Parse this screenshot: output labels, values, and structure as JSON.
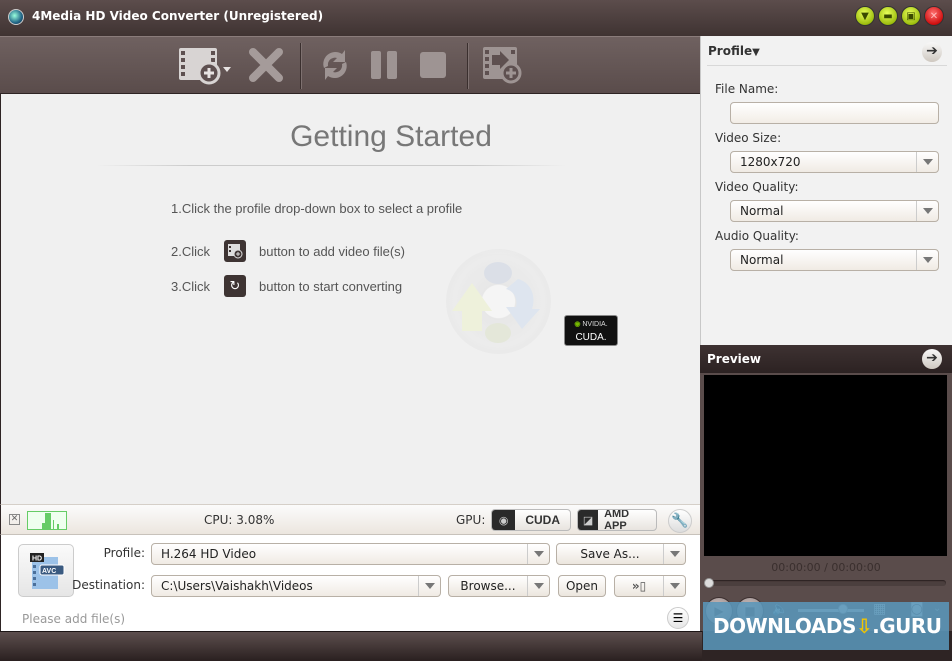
{
  "window": {
    "title": "4Media HD Video Converter (Unregistered)",
    "controls": [
      "menu",
      "minimize",
      "maximize",
      "close"
    ]
  },
  "toolbar": {
    "buttons": [
      {
        "name": "add-video",
        "icon": "film-plus-icon",
        "has_dropdown": true
      },
      {
        "name": "remove",
        "icon": "x-icon"
      },
      {
        "name": "convert",
        "icon": "refresh-icon"
      },
      {
        "name": "pause",
        "icon": "pause-icon"
      },
      {
        "name": "stop",
        "icon": "stop-icon"
      },
      {
        "name": "add-to-output",
        "icon": "film-arrow-plus-icon"
      }
    ]
  },
  "getting_started": {
    "title": "Getting Started",
    "step1": "1.Click the profile drop-down box to select a profile",
    "step2_prefix": "2.Click",
    "step2_suffix": "button to add video file(s)",
    "step3_prefix": "3.Click",
    "step3_suffix": "button to start converting",
    "badge_brand": "NVIDIA.",
    "badge_text": "CUDA."
  },
  "status": {
    "cpu": "CPU: 3.08%",
    "gpu_label": "GPU:",
    "cuda_label": "CUDA",
    "amd_label": "AMD APP"
  },
  "output": {
    "profile_label": "Profile:",
    "profile_value": "H.264 HD Video",
    "save_as_label": "Save As...",
    "destination_label": "Destination:",
    "destination_value": "C:\\Users\\Vaishakh\\Videos",
    "browse_label": "Browse...",
    "open_label": "Open",
    "status_text": "Please add file(s)"
  },
  "profile_panel": {
    "title": "Profile",
    "file_name_label": "File Name:",
    "file_name_value": "",
    "video_size_label": "Video Size:",
    "video_size_value": "1280x720",
    "video_quality_label": "Video Quality:",
    "video_quality_value": "Normal",
    "audio_quality_label": "Audio Quality:",
    "audio_quality_value": "Normal"
  },
  "preview_panel": {
    "title": "Preview",
    "time": "00:00:00 / 00:00:00",
    "seek_progress": 0,
    "volume_level": 0.68
  },
  "watermark": {
    "left": "DOWNLOADS",
    "right": ".GURU"
  }
}
